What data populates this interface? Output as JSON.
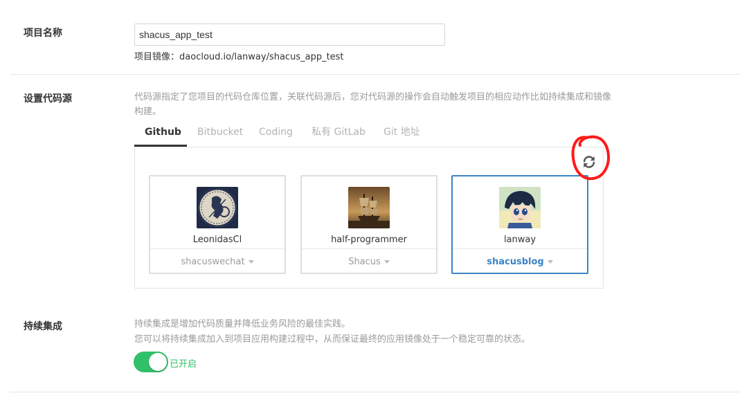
{
  "project": {
    "label": "项目名称",
    "name_value": "shacus_app_test",
    "mirror_key": "项目镜像：",
    "mirror_value": "daocloud.io/lanway/shacus_app_test"
  },
  "code_source": {
    "label": "设置代码源",
    "description": "代码源指定了您项目的代码仓库位置，关联代码源后，您对代码源的操作会自动触发项目的相应动作比如持续集成和镜像构建。",
    "tabs": [
      {
        "label": "Github",
        "active": true
      },
      {
        "label": "Bitbucket",
        "active": false
      },
      {
        "label": "Coding",
        "active": false
      },
      {
        "label": "私有 GitLab",
        "active": false
      },
      {
        "label": "Git 地址",
        "active": false
      }
    ],
    "accounts": [
      {
        "username": "LeonidasCl",
        "org": "shacuswechat",
        "selected": false,
        "avatar_icon": "greek-warrior-avatar"
      },
      {
        "username": "half-programmer",
        "org": "Shacus",
        "selected": false,
        "avatar_icon": "sailing-ship-avatar"
      },
      {
        "username": "lanway",
        "org": "shacusblog",
        "selected": true,
        "avatar_icon": "anime-character-avatar"
      }
    ],
    "refresh_icon": "refresh-icon",
    "accent_color": "#3a84c4",
    "annotation_color": "#ff1a1a"
  },
  "ci": {
    "label": "持续集成",
    "description_line1": "持续集成是增加代码质量并降低业务风险的最佳实践。",
    "description_line2": "您可以将持续集成加入到项目应用构建过程中，从而保证最终的应用镜像处于一个稳定可靠的状态。",
    "toggle_on": true,
    "toggle_label": "已开启",
    "toggle_color": "#2fc069"
  }
}
